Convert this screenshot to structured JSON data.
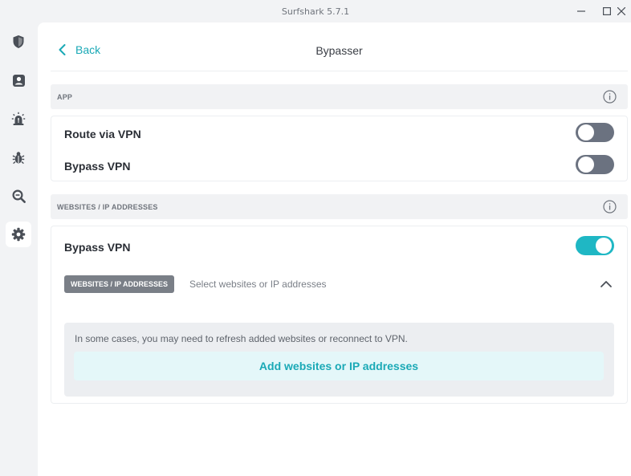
{
  "window": {
    "title": "Surfshark 5.7.1"
  },
  "sidebar": {
    "items": [
      {
        "icon": "shield-icon",
        "label": "VPN"
      },
      {
        "icon": "person-icon",
        "label": "Account"
      },
      {
        "icon": "alert-icon",
        "label": "Alert"
      },
      {
        "icon": "bug-icon",
        "label": "Antivirus"
      },
      {
        "icon": "search-icon",
        "label": "Search"
      },
      {
        "icon": "gear-icon",
        "label": "Settings",
        "active": true
      }
    ]
  },
  "header": {
    "back_label": "Back",
    "title": "Bypasser"
  },
  "app_section": {
    "header": "APP",
    "rows": [
      {
        "label": "Route via VPN",
        "enabled": false
      },
      {
        "label": "Bypass VPN",
        "enabled": false
      }
    ]
  },
  "websites_section": {
    "header": "WEBSITES / IP ADDRESSES",
    "bypass_label": "Bypass VPN",
    "bypass_enabled": true,
    "chip_label": "WEBSITES / IP ADDRESSES",
    "select_placeholder": "Select websites or IP addresses",
    "note": "In some cases, you may need to refresh added websites or reconnect to VPN.",
    "add_button_label": "Add websites or IP addresses"
  },
  "colors": {
    "accent": "#1fb7c4",
    "link": "#1aa9b6",
    "toggle_off": "#6b7280",
    "chip": "#7a7f87"
  }
}
